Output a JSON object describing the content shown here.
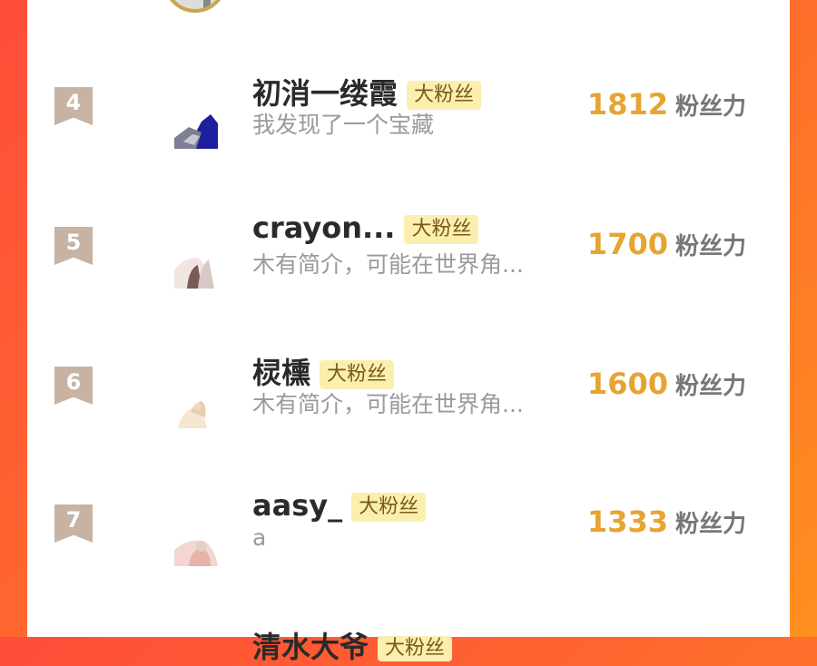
{
  "top_avatar": {
    "name": "avatar-rank-3"
  },
  "rows": [
    {
      "rank": "4",
      "username": "初消一缕霞",
      "tag": "大粉丝",
      "bio": "我发现了一个宝藏",
      "score": "1812",
      "score_unit": "粉丝力"
    },
    {
      "rank": "5",
      "username": "crayon...",
      "tag": "大粉丝",
      "bio": "木有简介，可能在世界角...",
      "score": "1700",
      "score_unit": "粉丝力"
    },
    {
      "rank": "6",
      "username": "棂櫄",
      "tag": "大粉丝",
      "bio": "木有简介，可能在世界角...",
      "score": "1600",
      "score_unit": "粉丝力"
    },
    {
      "rank": "7",
      "username": "aasy_",
      "tag": "大粉丝",
      "bio": "a",
      "score": "1333",
      "score_unit": "粉丝力"
    }
  ],
  "partial_row": {
    "username": "清水大爷",
    "tag": "大粉丝"
  },
  "colors": {
    "background_gradient_start": "#ff4d3a",
    "background_gradient_end": "#ff8f1f",
    "score": "#e6a431",
    "tag_bg": "#fbefb0",
    "tag_text": "#7b5a16",
    "rank_badge": "#c6b3a3"
  }
}
